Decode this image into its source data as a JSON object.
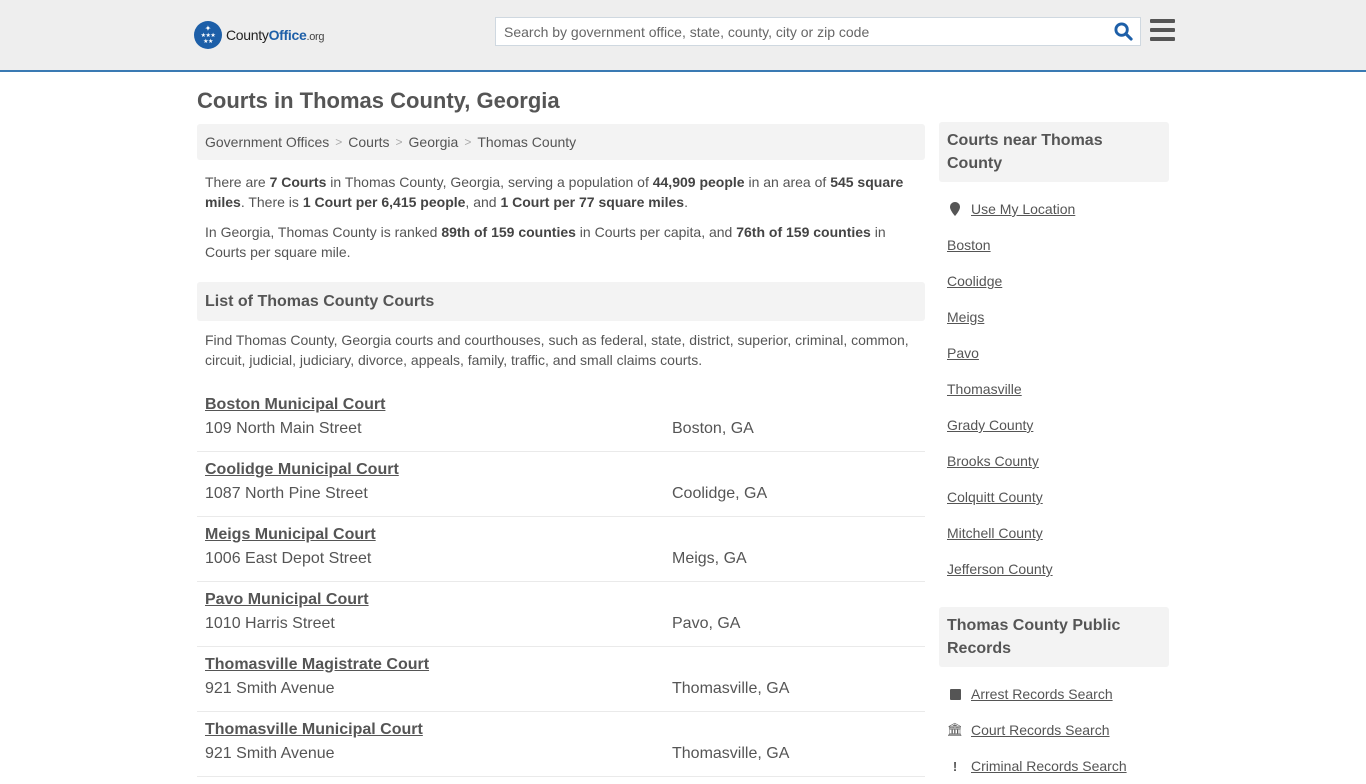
{
  "header": {
    "logo": {
      "county": "County",
      "office": "Office",
      "org": ".org",
      "icon": "eagle-stars-icon"
    },
    "search": {
      "placeholder": "Search by government office, state, county, city or zip code",
      "value": "",
      "button_icon": "search-icon"
    },
    "menu_icon": "hamburger-menu-icon",
    "colors": {
      "brand": "#1d5fa8",
      "header_border": "#3a7ab3",
      "header_bg": "#eeeeee"
    }
  },
  "page": {
    "title": "Courts in Thomas County, Georgia"
  },
  "breadcrumb": [
    {
      "label": "Government Offices"
    },
    {
      "label": "Courts"
    },
    {
      "label": "Georgia"
    },
    {
      "label": "Thomas County"
    }
  ],
  "breadcrumb_separator": ">",
  "intro": {
    "p1": {
      "t1": "There are ",
      "b1": "7 Courts",
      "t2": " in Thomas County, Georgia, serving a population of ",
      "b2": "44,909 people",
      "t3": " in an area of ",
      "b3": "545 square miles",
      "t4": ". There is ",
      "b4": "1 Court per 6,415 people",
      "t5": ", and ",
      "b5": "1 Court per 77 square miles",
      "t6": "."
    },
    "p2": {
      "t1": "In Georgia, Thomas County is ranked ",
      "b1": "89th of 159 counties",
      "t2": " in Courts per capita, and ",
      "b2": "76th of 159 counties",
      "t3": " in Courts per square mile."
    }
  },
  "list_section": {
    "title": "List of Thomas County Courts",
    "description": "Find Thomas County, Georgia courts and courthouses, such as federal, state, district, superior, criminal, common, circuit, judicial, judiciary, divorce, appeals, family, traffic, and small claims courts."
  },
  "courts": [
    {
      "name": "Boston Municipal Court",
      "address": "109 North Main Street",
      "city": "Boston, GA"
    },
    {
      "name": "Coolidge Municipal Court",
      "address": "1087 North Pine Street",
      "city": "Coolidge, GA"
    },
    {
      "name": "Meigs Municipal Court",
      "address": "1006 East Depot Street",
      "city": "Meigs, GA"
    },
    {
      "name": "Pavo Municipal Court",
      "address": "1010 Harris Street",
      "city": "Pavo, GA"
    },
    {
      "name": "Thomasville Magistrate Court",
      "address": "921 Smith Avenue",
      "city": "Thomasville, GA"
    },
    {
      "name": "Thomasville Municipal Court",
      "address": "921 Smith Avenue",
      "city": "Thomasville, GA"
    }
  ],
  "sidebar": {
    "nearby_title": "Courts near Thomas County",
    "use_location": {
      "label": "Use My Location",
      "icon": "map-pin-icon"
    },
    "nearby": [
      {
        "label": "Boston"
      },
      {
        "label": "Coolidge"
      },
      {
        "label": "Meigs"
      },
      {
        "label": "Pavo"
      },
      {
        "label": "Thomasville"
      },
      {
        "label": "Grady County"
      },
      {
        "label": "Brooks County"
      },
      {
        "label": "Colquitt County"
      },
      {
        "label": "Mitchell County"
      },
      {
        "label": "Jefferson County"
      }
    ],
    "records_title": "Thomas County Public Records",
    "records": [
      {
        "label": "Arrest Records Search",
        "icon": "square-icon"
      },
      {
        "label": "Court Records Search",
        "icon": "courthouse-icon"
      },
      {
        "label": "Criminal Records Search",
        "icon": "exclamation-icon"
      }
    ]
  }
}
